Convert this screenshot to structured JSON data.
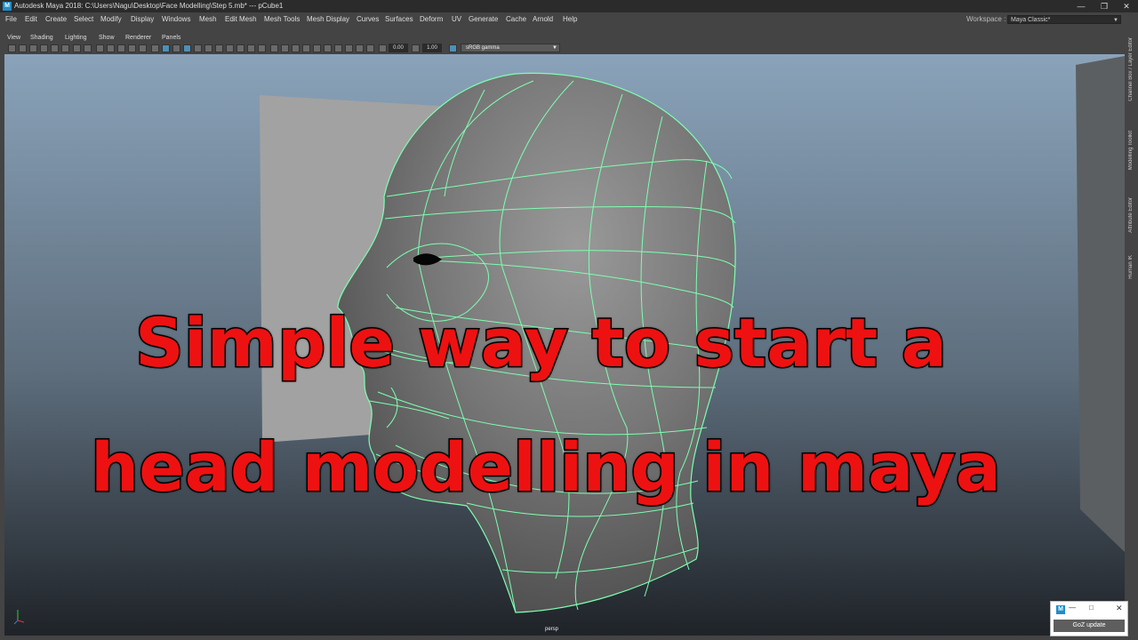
{
  "titlebar": {
    "logo": "M",
    "title": "Autodesk Maya 2018: C:\\Users\\Nagu\\Desktop\\Face Modelling\\Step 5.mb*   ---   pCube1",
    "minimize": "—",
    "maximize": "❐",
    "close": "✕"
  },
  "menubar": {
    "items": [
      "File",
      "Edit",
      "Create",
      "Select",
      "Modify",
      "Display",
      "Windows",
      "Mesh",
      "Edit Mesh",
      "Mesh Tools",
      "Mesh Display",
      "Curves",
      "Surfaces",
      "Deform",
      "UV",
      "Generate",
      "Cache",
      "Arnold",
      "Help"
    ],
    "workspace_label": "Workspace :",
    "workspace_value": "Maya Classic*"
  },
  "panel_menu": {
    "items": [
      "View",
      "Shading",
      "Lighting",
      "Show",
      "Renderer",
      "Panels"
    ]
  },
  "panel_toolbar": {
    "exposure": "0.00",
    "gamma": "1.00",
    "color_space": "sRGB gamma"
  },
  "side_tabs": [
    "Channel Box / Layer Editor",
    "Modelling Toolkit",
    "Attribute Editor",
    "Human IK"
  ],
  "viewport": {
    "camera_label": "persp",
    "colors": {
      "wireframe": "#7dffb0",
      "mesh": "#7a7a7a",
      "background_top": "#8aa3ba",
      "background_bottom": "#1f2328"
    }
  },
  "caption": {
    "line1": "Simple way to start a",
    "line2": "head modelling in maya",
    "color": "#ee1111"
  },
  "goz_window": {
    "icon": "M",
    "minimize": "—",
    "maximize": "□",
    "close": "✕",
    "button_label": "GoZ update"
  }
}
